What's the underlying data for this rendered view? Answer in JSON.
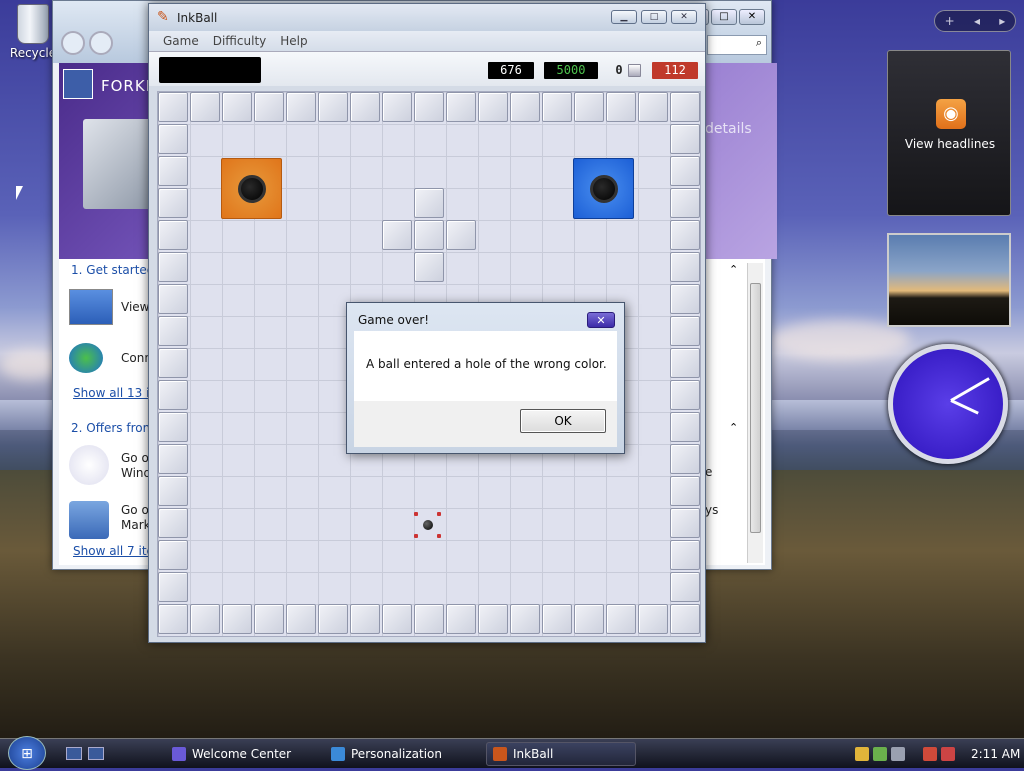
{
  "desktop": {
    "recycle_bin_label": "Recycle"
  },
  "welcome_center": {
    "banner_title": "FORKI",
    "banner_details": "details",
    "section1_heading": "1. Get started w",
    "item1_label": "View",
    "item2_label": "Conn",
    "show_all_13": "Show all 13 ite",
    "section2_heading": "2. Offers from",
    "offer1_line1": "Go o",
    "offer1_line2": "Wind",
    "offer2_line1": "Go o",
    "offer2_line2": "Mark",
    "show_all_7": "Show all 7 ite",
    "right_fragment_e": "e",
    "right_fragment_ys": "ys"
  },
  "inkball": {
    "title": "InkBall",
    "menu": [
      "Game",
      "Difficulty",
      "Help"
    ],
    "time": "676",
    "target": "5000",
    "balls_left": "0",
    "score": "112",
    "colors": {
      "orange_hole": "#e0751a",
      "blue_hole": "#1c5fd6",
      "score_red": "#c0392b",
      "target_green": "#4ec24e"
    }
  },
  "dialog": {
    "title": "Game over!",
    "message": "A ball entered a hole of the wrong color.",
    "ok_label": "OK"
  },
  "sidebar": {
    "add_gadget": "+",
    "feed_label": "View headlines"
  },
  "taskbar": {
    "start_icon": "windows-logo",
    "items": [
      "Welcome Center",
      "Personalization",
      "InkBall"
    ],
    "clock": "2:11 AM"
  }
}
